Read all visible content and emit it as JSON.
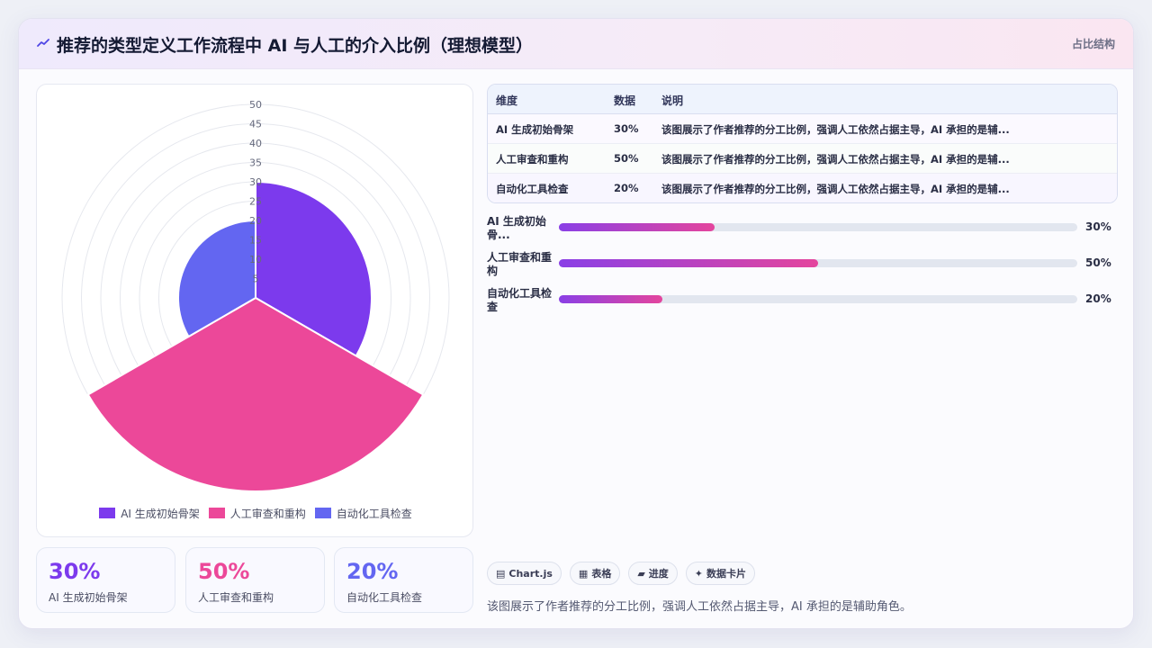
{
  "header": {
    "title": "推荐的类型定义工作流程中 AI 与人工的介入比例（理想模型）",
    "tag": "占比结构",
    "icon": "trend-line-icon"
  },
  "colors": {
    "ai": "#7c3aed",
    "human": "#ec4899",
    "tool": "#6366f1",
    "accent_gradient": [
      "#8a3fe6",
      "#e4459d"
    ]
  },
  "chart_data": {
    "type": "polarArea",
    "categories": [
      "AI 生成初始骨架",
      "人工审查和重构",
      "自动化工具检查"
    ],
    "values": [
      30,
      50,
      20
    ],
    "colors": [
      "#7c3aed",
      "#ec4899",
      "#6366f1"
    ],
    "radial_ticks": [
      "5",
      "10",
      "15",
      "20",
      "25",
      "30",
      "35",
      "40",
      "45",
      "50"
    ],
    "rlim": [
      0,
      50
    ],
    "legend_position": "bottom"
  },
  "stats": [
    {
      "value": "30%",
      "label": "AI 生成初始骨架",
      "color": "#7c3aed"
    },
    {
      "value": "50%",
      "label": "人工审查和重构",
      "color": "#ec4899"
    },
    {
      "value": "20%",
      "label": "自动化工具检查",
      "color": "#6366f1"
    }
  ],
  "table": {
    "headers": [
      "维度",
      "数据",
      "说明"
    ],
    "rows": [
      [
        "AI 生成初始骨架",
        "30%",
        "该图展示了作者推荐的分工比例，强调人工依然占据主导，AI 承担的是辅..."
      ],
      [
        "人工审查和重构",
        "50%",
        "该图展示了作者推荐的分工比例，强调人工依然占据主导，AI 承担的是辅..."
      ],
      [
        "自动化工具检查",
        "20%",
        "该图展示了作者推荐的分工比例，强调人工依然占据主导，AI 承担的是辅..."
      ]
    ]
  },
  "progress": [
    {
      "label": "AI 生成初始骨...",
      "value": 30,
      "display": "30%"
    },
    {
      "label": "人工审查和重构",
      "value": 50,
      "display": "50%"
    },
    {
      "label": "自动化工具检查",
      "value": 20,
      "display": "20%"
    }
  ],
  "tags": [
    {
      "icon": "chart-icon",
      "glyph": "▤",
      "label": "Chart.js"
    },
    {
      "icon": "table-icon",
      "glyph": "▦",
      "label": "表格"
    },
    {
      "icon": "progress-icon",
      "glyph": "▰",
      "label": "进度"
    },
    {
      "icon": "sparkle-icon",
      "glyph": "✦",
      "label": "数据卡片"
    }
  ],
  "summary": "该图展示了作者推荐的分工比例，强调人工依然占据主导，AI 承担的是辅助角色。"
}
